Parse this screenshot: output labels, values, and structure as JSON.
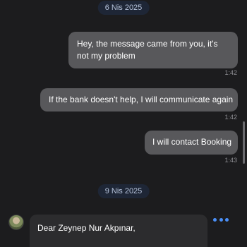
{
  "dates": [
    "6 Nis 2025",
    "9 Nis 2025"
  ],
  "messages": [
    {
      "text": "Hey, the message came from you, it's not my problem",
      "time": "1:42"
    },
    {
      "text": "If the bank doesn't help, I will communicate again",
      "time": "1:42"
    },
    {
      "text": "I will contact Booking",
      "time": "1:43"
    }
  ],
  "incoming": {
    "text": "Dear Zeynep Nur Akpınar,"
  },
  "colors": {
    "accent": "#4a8ff7",
    "outgoing_bubble": "#58585b",
    "incoming_bubble": "#2c2c2e",
    "background": "#1c1c1e"
  },
  "icons": {
    "more": "more-dots-icon",
    "avatar": "avatar"
  }
}
